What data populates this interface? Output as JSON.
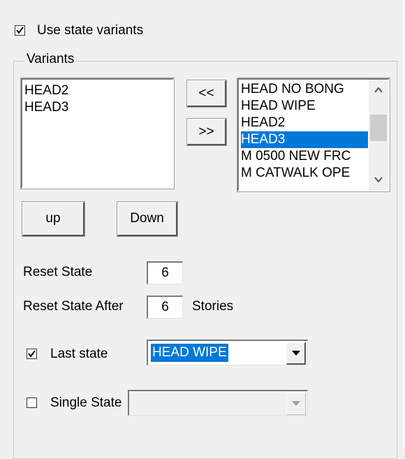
{
  "use_state_variants": {
    "label": "Use state variants",
    "checked": true
  },
  "variants_group": {
    "title": "Variants"
  },
  "selected_list": {
    "items": [
      "HEAD2",
      "HEAD3"
    ]
  },
  "move_left_button": {
    "label": "<<"
  },
  "move_right_button": {
    "label": ">>"
  },
  "available_list": {
    "items": [
      "HEAD NO BONG",
      "HEAD WIPE",
      "HEAD2",
      "HEAD3",
      "M 0500 NEW FRC",
      "M CATWALK OPE"
    ],
    "selected": "HEAD3"
  },
  "up_button": {
    "label": "up"
  },
  "down_button": {
    "label": "Down"
  },
  "reset_state": {
    "label": "Reset State",
    "value": "6"
  },
  "reset_state_after": {
    "label": "Reset State After",
    "value": "6",
    "suffix": "Stories"
  },
  "last_state": {
    "label": "Last state",
    "checked": true,
    "value": "HEAD WIPE"
  },
  "single_state": {
    "label": "Single State",
    "checked": false,
    "value": ""
  },
  "colors": {
    "selection": "#0078d7",
    "background": "#f0f0f0"
  }
}
